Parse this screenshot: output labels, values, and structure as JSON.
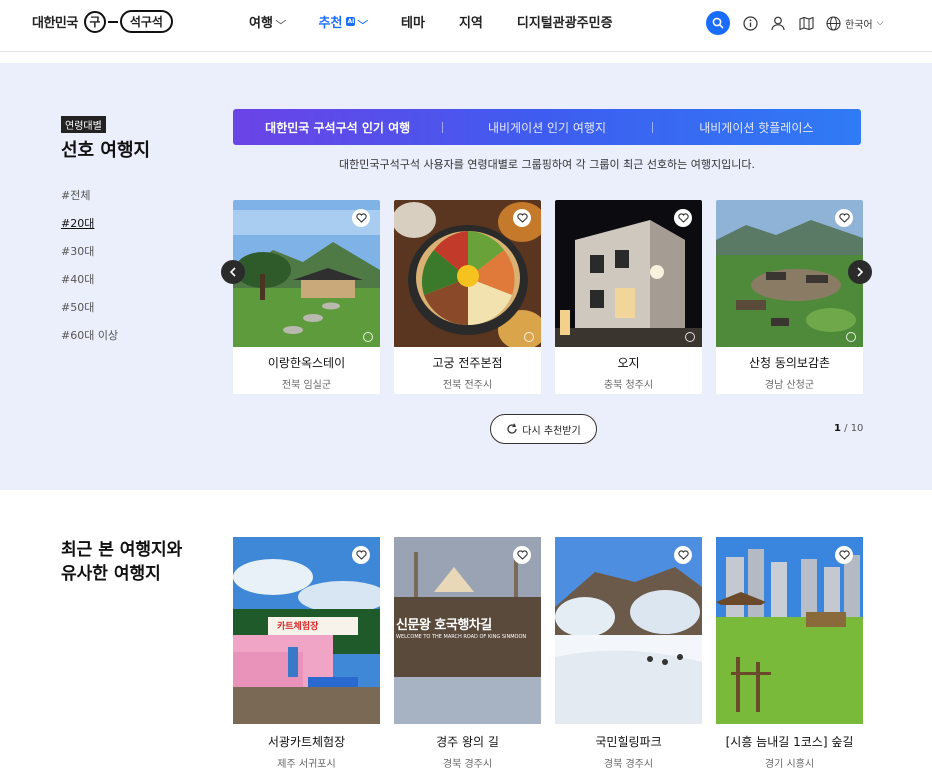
{
  "header": {
    "logo_text": "대한민국",
    "logo_mark": "구",
    "logo_pill": "석구석",
    "nav": [
      {
        "label": "여행",
        "has_dropdown": true,
        "active": false
      },
      {
        "label": "추천",
        "has_dropdown": true,
        "active": true,
        "badge": "AI"
      },
      {
        "label": "테마",
        "has_dropdown": false,
        "active": false
      },
      {
        "label": "지역",
        "has_dropdown": false,
        "active": false
      },
      {
        "label": "디지털관광주민증",
        "has_dropdown": false,
        "active": false
      }
    ],
    "language": "한국어",
    "icons": [
      "search-icon",
      "info-icon",
      "user-icon",
      "map-icon",
      "globe-icon"
    ],
    "accent_color": "#1a6cff"
  },
  "preferred": {
    "badge": "연령대별",
    "title": "선호 여행지",
    "ages": [
      "#전체",
      "#20대",
      "#30대",
      "#40대",
      "#50대",
      "#60대 이상"
    ],
    "active_age": "#20대",
    "tabs": [
      "대한민국 구석구석 인기 여행",
      "내비게이션 인기 여행지",
      "내비게이션 핫플레이스"
    ],
    "description": "대한민국구석구석 사용자를 연령대별로 그룹핑하여 각 그룹이 최근 선호하는 여행지입니다.",
    "cards": [
      {
        "name": "이랑한옥스테이",
        "region": "전북 임실군"
      },
      {
        "name": "고궁 전주본점",
        "region": "전북 전주시"
      },
      {
        "name": "오지",
        "region": "충북 청주시"
      },
      {
        "name": "산청 동의보감촌",
        "region": "경남 산청군"
      }
    ],
    "refresh_label": "다시 추천받기",
    "page_current": "1",
    "page_total": " / 10"
  },
  "recent": {
    "title_line1": "최근 본 여행지와",
    "title_line2": "유사한 여행지",
    "cards": [
      {
        "name": "서광카트체험장",
        "region": "제주 서귀포시",
        "sign": "카트체험장"
      },
      {
        "name": "경주 왕의 길",
        "region": "경북 경주시",
        "sign": "신문왕 호국행차길",
        "sign_sub": "WELCOME TO THE MARCH ROAD OF KING SINMOON"
      },
      {
        "name": "국민힐링파크",
        "region": "경북 경주시"
      },
      {
        "name": "[시흥 늠내길 1코스] 숲길",
        "region": "경기 시흥시"
      }
    ]
  }
}
